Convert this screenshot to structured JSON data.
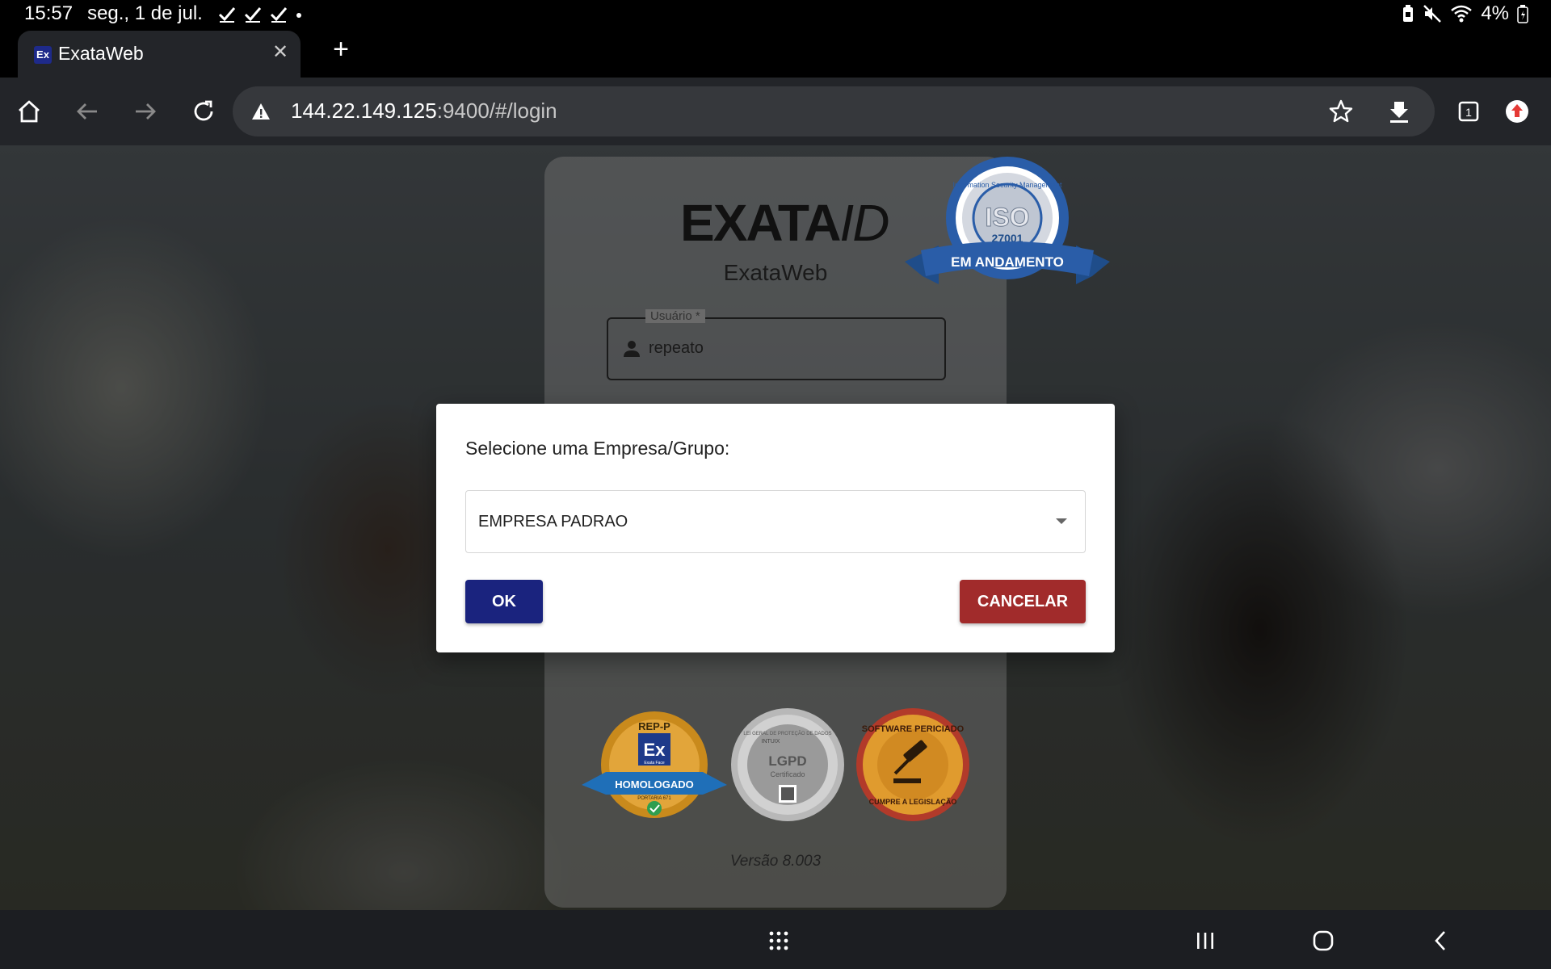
{
  "status_bar": {
    "time": "15:57",
    "date": "seg., 1 de jul.",
    "battery": "4%",
    "icons": [
      "check-icon",
      "check-icon",
      "check-icon",
      "dot-icon",
      "battery-saver-icon",
      "mute-icon",
      "wifi-icon",
      "battery-icon"
    ]
  },
  "browser": {
    "tab": {
      "title": "ExataWeb",
      "favicon": "Ex"
    },
    "url_host": "144.22.149.125",
    "url_path": ":9400/#/login",
    "tab_count": "1"
  },
  "login": {
    "logo_main": "EXATA",
    "logo_id": "ID",
    "app_name": "ExataWeb",
    "iso_seal": {
      "top": "Information Security Management",
      "mid": "ISO",
      "num": "27001",
      "ribbon": "EM ANDAMENTO"
    },
    "user_label": "Usuário *",
    "user_value": "repeato",
    "badges": {
      "rep": {
        "top": "REP-P",
        "logo": "Ex",
        "sub": "Exata Face",
        "ribbon": "HOMOLOGADO",
        "small": "PORTARIA 671"
      },
      "lgpd": {
        "ring": "LEI GERAL DE PROTEÇÃO DE DADOS",
        "brand": "INTUIX",
        "title": "LGPD",
        "sub": "Certificado"
      },
      "pericia": {
        "top": "SOFTWARE PERICIADO",
        "bottom": "CUMPRE A LEGISLAÇÃO"
      }
    },
    "version": "Versão 8.003"
  },
  "dialog": {
    "prompt": "Selecione uma Empresa/Grupo:",
    "selected_company": "EMPRESA PADRAO",
    "ok_label": "OK",
    "cancel_label": "CANCELAR",
    "ok_color": "#1a237e",
    "cancel_color": "#a12b2b"
  }
}
